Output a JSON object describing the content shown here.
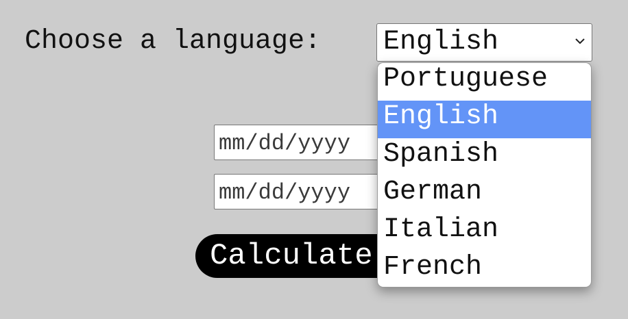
{
  "language_picker": {
    "label": "Choose a language:",
    "selected": "English",
    "options": [
      "Portuguese",
      "English",
      "Spanish",
      "German",
      "Italian",
      "French"
    ],
    "highlighted_index": 1
  },
  "date_inputs": [
    {
      "placeholder": "mm/dd/yyyy"
    },
    {
      "placeholder": "mm/dd/yyyy"
    }
  ],
  "calculate_button": {
    "label": "Calculate"
  },
  "colors": {
    "background": "#cccccc",
    "highlight": "#6394f7",
    "button": "#000000"
  },
  "icons": {
    "select_arrow": "chevron-down-icon"
  }
}
